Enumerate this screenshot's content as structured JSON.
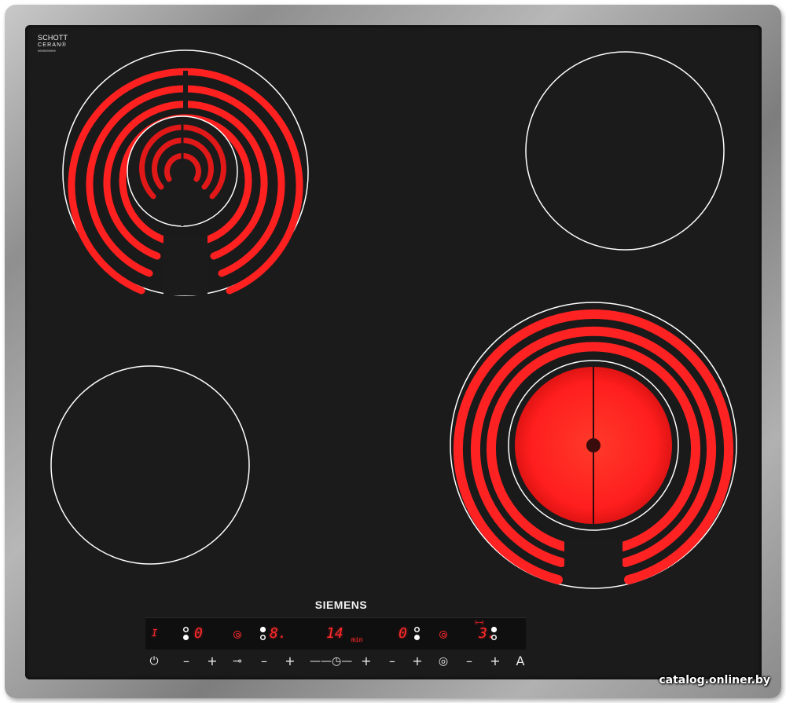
{
  "product": {
    "glass_logo": {
      "line1": "SCHOTT",
      "line2": "CERAN®",
      "line3": "0000000000"
    },
    "brand_name": "SIEMENS",
    "colors": {
      "glass": "#1b1b1c",
      "frame": "#a0a0a0",
      "heat": "#ff1f1f",
      "display_digits": "#ff2a2a",
      "zone_outline": "#ffffff"
    }
  },
  "zones": [
    {
      "name": "front-left",
      "state": "off"
    },
    {
      "name": "rear-left",
      "state": "on",
      "type": "dual-circuit"
    },
    {
      "name": "rear-right",
      "state": "off"
    },
    {
      "name": "front-right",
      "state": "on",
      "type": "dual-circuit"
    }
  ],
  "display": {
    "indicator_1": "I",
    "zone1_level": "0",
    "zone2_level": "8.",
    "timer_value": "14",
    "timer_unit": "min",
    "zone3_level": "0",
    "zone4_level": "3.",
    "zone4_icon": "⊢⊣"
  },
  "controls": {
    "power": "⏻",
    "minus1": "–",
    "plus1": "+",
    "lock_icon": "⊸",
    "minus2": "–",
    "plus2": "+",
    "timer_icon": "——◷—",
    "plus3": "+",
    "minus4": "–",
    "plus4": "+",
    "zone_select": "◎",
    "minus5": "–",
    "plus5": "+",
    "auto": "A"
  },
  "watermark": "catalog.onliner.by"
}
